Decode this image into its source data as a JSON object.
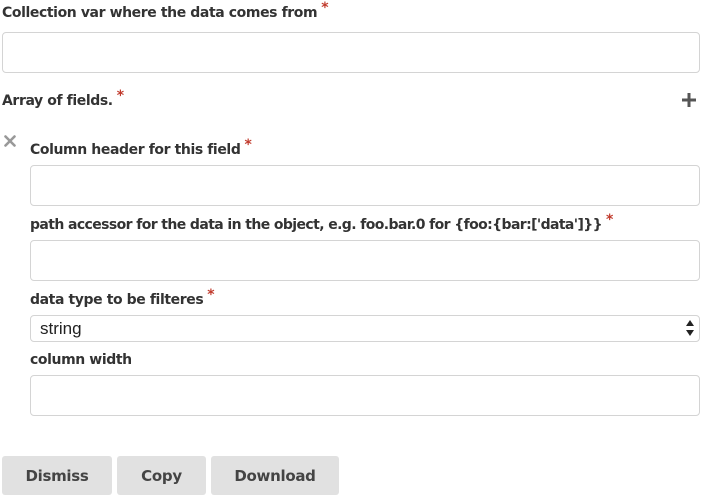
{
  "form": {
    "collection_var": {
      "label": "Collection var where the data comes from",
      "required": "*",
      "value": ""
    },
    "fields_array": {
      "label": "Array of fields.",
      "required": "*",
      "add_icon": "plus-icon",
      "remove_icon": "x-icon"
    },
    "column_header": {
      "label": "Column header for this field",
      "required": "*",
      "value": ""
    },
    "path_accessor": {
      "label": "path accessor for the data in the object, e.g. foo.bar.0 for {foo:{bar:['data']}}",
      "required": "*",
      "value": ""
    },
    "data_type": {
      "label": "data type to be filteres",
      "required": "*",
      "selected": "string"
    },
    "column_width": {
      "label": "column width",
      "value": ""
    }
  },
  "buttons": {
    "dismiss": "Dismiss",
    "copy": "Copy",
    "download": "Download"
  },
  "colors": {
    "required": "#c0392b",
    "button_bg": "#e1e1e1",
    "border": "#d4d4d4"
  }
}
